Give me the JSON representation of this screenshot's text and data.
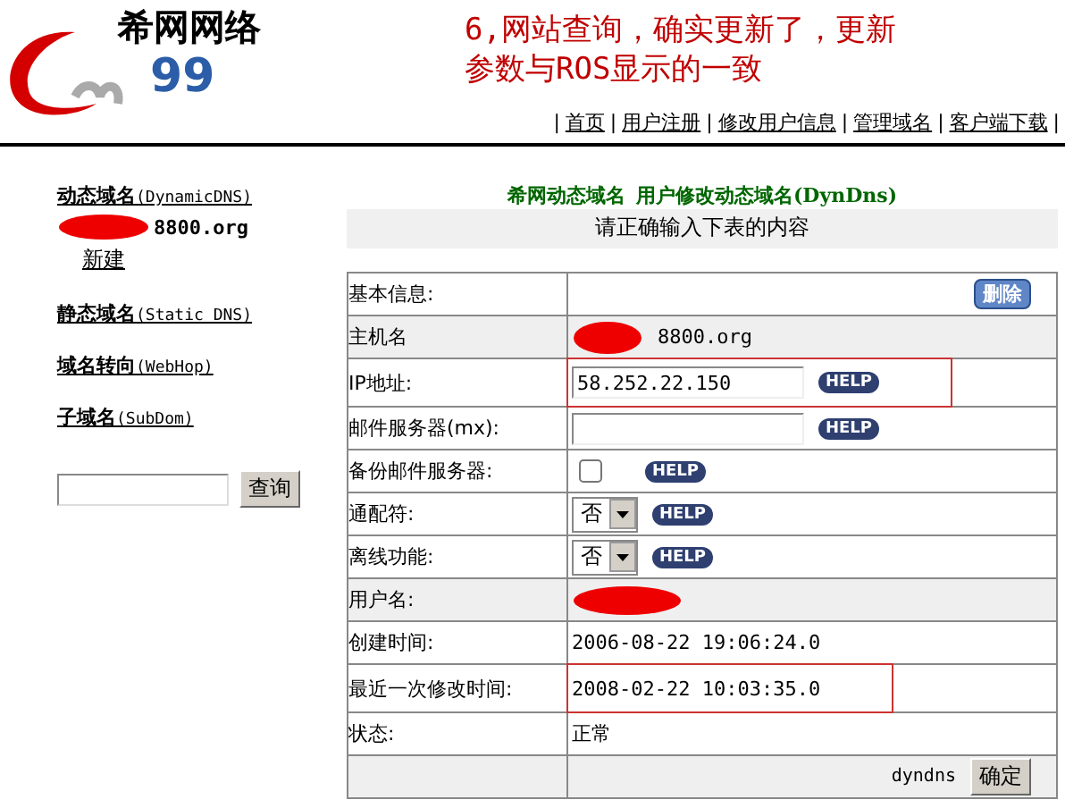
{
  "logo": {
    "name": "希网网络",
    "number": "99"
  },
  "annotation": [
    "6,网站查询，确实更新了，更新",
    "参数与ROS显示的一致"
  ],
  "nav": [
    "首页",
    "用户注册",
    "修改用户信息",
    "管理域名",
    "客户端下载"
  ],
  "nav_separator": "|",
  "sidebar": {
    "sections": [
      {
        "title": "动态域名",
        "sub": "(DynamicDNS)",
        "domain": "8800.org",
        "new": "新建"
      },
      {
        "title": "静态域名",
        "sub": "(Static DNS)"
      },
      {
        "title": "域名转向",
        "sub": "(WebHop)"
      },
      {
        "title": "子域名",
        "sub": "(SubDom)"
      }
    ],
    "search_button": "查询"
  },
  "form": {
    "title": "希网动态域名",
    "title2": "用户修改动态域名",
    "title_sub": "(DynDns)",
    "subtitle": "请正确输入下表的内容",
    "rows": [
      {
        "label": "基本信息:",
        "kind": "delete",
        "button": "删除",
        "shaded": false,
        "highlighted": false
      },
      {
        "label": "主机名",
        "kind": "host",
        "value": "8800.org",
        "shaded": true,
        "highlighted": false
      },
      {
        "label": "IP地址:",
        "kind": "input",
        "value": "58.252.22.150",
        "help": "HELP",
        "shaded": false,
        "highlighted": true
      },
      {
        "label": "邮件服务器(mx):",
        "kind": "input",
        "help": "HELP",
        "shaded": false,
        "highlighted": false
      },
      {
        "label": "备份邮件服务器:",
        "kind": "checkbox",
        "checked": false,
        "help": "HELP",
        "shaded": false,
        "highlighted": false
      },
      {
        "label": "通配符:",
        "kind": "select",
        "value": "否",
        "help": "HELP",
        "shaded": false,
        "highlighted": false
      },
      {
        "label": "离线功能:",
        "kind": "select",
        "value": "否",
        "help": "HELP",
        "shaded": false,
        "highlighted": false
      },
      {
        "label": "用户名:",
        "kind": "redacted",
        "shaded": true,
        "highlighted": false
      },
      {
        "label": "创建时间:",
        "kind": "text",
        "value": "2006-08-22 19:06:24.0",
        "shaded": false,
        "highlighted": false
      },
      {
        "label": "最近一次修改时间:",
        "kind": "text",
        "value": "2008-02-22 10:03:35.0",
        "shaded": false,
        "highlighted": true
      },
      {
        "label": "状态:",
        "kind": "text",
        "value": "正常",
        "shaded": false,
        "highlighted": false
      },
      {
        "kind": "submit",
        "value": "dyndns",
        "button": "确定",
        "shaded": true,
        "highlighted": false
      }
    ]
  }
}
